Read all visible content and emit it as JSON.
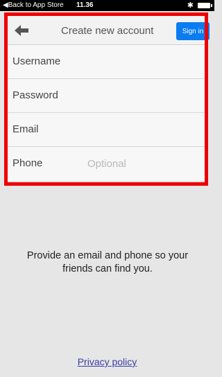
{
  "status_bar": {
    "back_label": "◀Back to App Store",
    "time": "11.36",
    "bluetooth_glyph": "✱"
  },
  "nav": {
    "title": "Create new account",
    "signin_label": "Sign in",
    "back_icon": "back-arrow-icon"
  },
  "form": {
    "fields": [
      {
        "label": "Username",
        "value": "",
        "placeholder": ""
      },
      {
        "label": "Password",
        "value": "",
        "placeholder": ""
      },
      {
        "label": "Email",
        "value": "",
        "placeholder": ""
      },
      {
        "label": "Phone",
        "value": "",
        "placeholder": "Optional"
      }
    ]
  },
  "info": {
    "text": "Provide an email and phone so your friends can find you."
  },
  "footer": {
    "privacy_label": "Privacy policy"
  },
  "colors": {
    "accent": "#0a7cf2",
    "highlight": "#ee0000",
    "background": "#e6e6e6",
    "link": "#3b3ba8"
  }
}
